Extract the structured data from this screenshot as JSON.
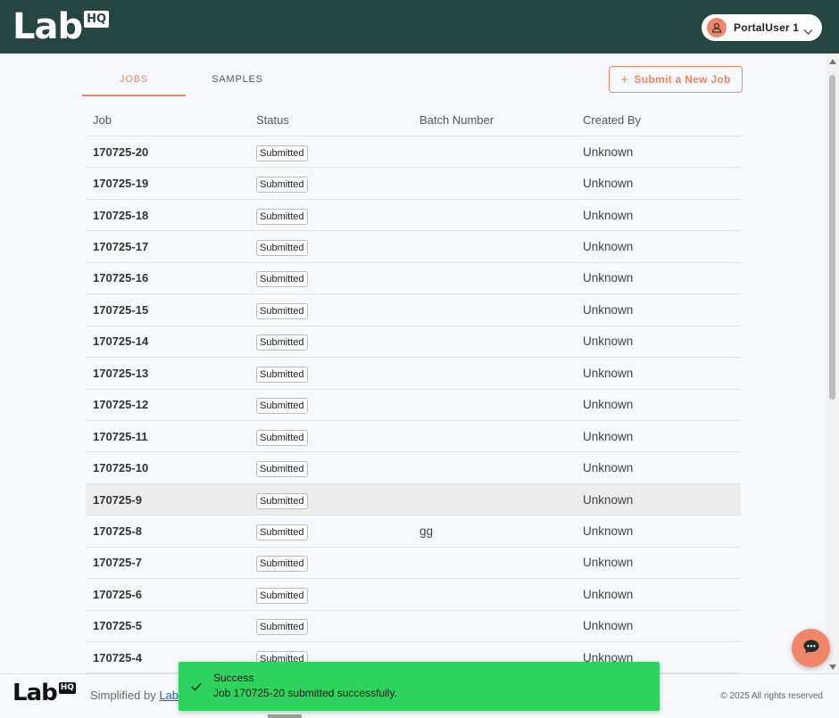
{
  "app": {
    "logo_text": "Lab",
    "logo_badge": "HQ"
  },
  "user": {
    "name": "PortalUser 1",
    "avatar_icon": "user-icon"
  },
  "tabs": [
    {
      "label": "JOBS",
      "active": true
    },
    {
      "label": "SAMPLES",
      "active": false
    }
  ],
  "submit_button": {
    "label": "Submit a New Job",
    "icon": "plus-icon"
  },
  "table": {
    "headers": [
      "Job",
      "Status",
      "Batch Number",
      "Created By"
    ],
    "rows": [
      {
        "job": "170725-20",
        "status": "Submitted",
        "batch": "",
        "created_by": "Unknown"
      },
      {
        "job": "170725-19",
        "status": "Submitted",
        "batch": "",
        "created_by": "Unknown"
      },
      {
        "job": "170725-18",
        "status": "Submitted",
        "batch": "",
        "created_by": "Unknown"
      },
      {
        "job": "170725-17",
        "status": "Submitted",
        "batch": "",
        "created_by": "Unknown"
      },
      {
        "job": "170725-16",
        "status": "Submitted",
        "batch": "",
        "created_by": "Unknown"
      },
      {
        "job": "170725-15",
        "status": "Submitted",
        "batch": "",
        "created_by": "Unknown"
      },
      {
        "job": "170725-14",
        "status": "Submitted",
        "batch": "",
        "created_by": "Unknown"
      },
      {
        "job": "170725-13",
        "status": "Submitted",
        "batch": "",
        "created_by": "Unknown"
      },
      {
        "job": "170725-12",
        "status": "Submitted",
        "batch": "",
        "created_by": "Unknown"
      },
      {
        "job": "170725-11",
        "status": "Submitted",
        "batch": "",
        "created_by": "Unknown"
      },
      {
        "job": "170725-10",
        "status": "Submitted",
        "batch": "",
        "created_by": "Unknown"
      },
      {
        "job": "170725-9",
        "status": "Submitted",
        "batch": "",
        "created_by": "Unknown"
      },
      {
        "job": "170725-8",
        "status": "Submitted",
        "batch": "gg",
        "created_by": "Unknown"
      },
      {
        "job": "170725-7",
        "status": "Submitted",
        "batch": "",
        "created_by": "Unknown"
      },
      {
        "job": "170725-6",
        "status": "Submitted",
        "batch": "",
        "created_by": "Unknown"
      },
      {
        "job": "170725-5",
        "status": "Submitted",
        "batch": "",
        "created_by": "Unknown"
      },
      {
        "job": "170725-4",
        "status": "Submitted",
        "batch": "",
        "created_by": "Unknown"
      }
    ]
  },
  "footer": {
    "logo_text": "Lab",
    "logo_badge": "HQ",
    "simplified_by": "Simplified by",
    "link_text": "Lab",
    "copyright": "© 2025 All rights reserved"
  },
  "toast": {
    "title": "Success",
    "message": "Job 170725-20 submitted successfully."
  },
  "colors": {
    "header_bg": "#244540",
    "accent": "#f08667",
    "toast_bg": "#2dd35d",
    "row_hover": "#ececec"
  }
}
